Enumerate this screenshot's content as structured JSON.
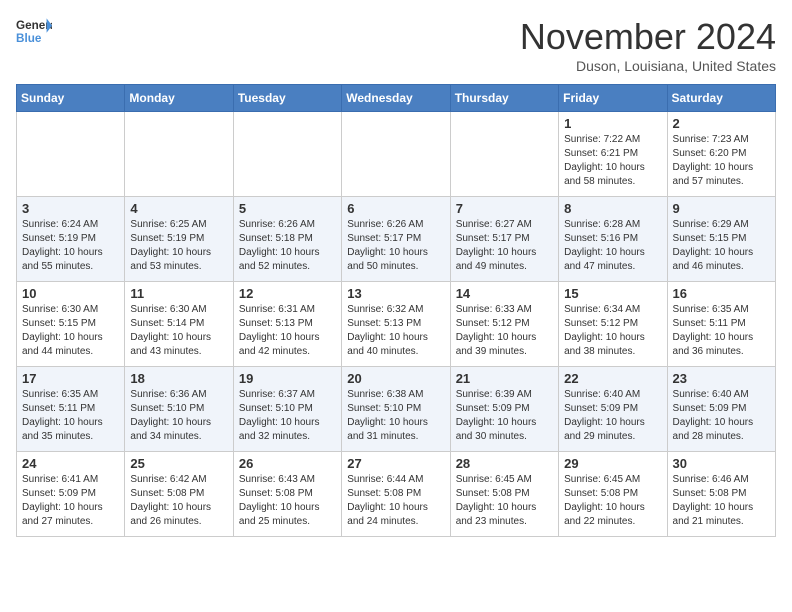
{
  "header": {
    "logo_line1": "General",
    "logo_line2": "Blue",
    "title": "November 2024",
    "subtitle": "Duson, Louisiana, United States"
  },
  "weekdays": [
    "Sunday",
    "Monday",
    "Tuesday",
    "Wednesday",
    "Thursday",
    "Friday",
    "Saturday"
  ],
  "weeks": [
    [
      {
        "day": "",
        "info": ""
      },
      {
        "day": "",
        "info": ""
      },
      {
        "day": "",
        "info": ""
      },
      {
        "day": "",
        "info": ""
      },
      {
        "day": "",
        "info": ""
      },
      {
        "day": "1",
        "info": "Sunrise: 7:22 AM\nSunset: 6:21 PM\nDaylight: 10 hours and 58 minutes."
      },
      {
        "day": "2",
        "info": "Sunrise: 7:23 AM\nSunset: 6:20 PM\nDaylight: 10 hours and 57 minutes."
      }
    ],
    [
      {
        "day": "3",
        "info": "Sunrise: 6:24 AM\nSunset: 5:19 PM\nDaylight: 10 hours and 55 minutes."
      },
      {
        "day": "4",
        "info": "Sunrise: 6:25 AM\nSunset: 5:19 PM\nDaylight: 10 hours and 53 minutes."
      },
      {
        "day": "5",
        "info": "Sunrise: 6:26 AM\nSunset: 5:18 PM\nDaylight: 10 hours and 52 minutes."
      },
      {
        "day": "6",
        "info": "Sunrise: 6:26 AM\nSunset: 5:17 PM\nDaylight: 10 hours and 50 minutes."
      },
      {
        "day": "7",
        "info": "Sunrise: 6:27 AM\nSunset: 5:17 PM\nDaylight: 10 hours and 49 minutes."
      },
      {
        "day": "8",
        "info": "Sunrise: 6:28 AM\nSunset: 5:16 PM\nDaylight: 10 hours and 47 minutes."
      },
      {
        "day": "9",
        "info": "Sunrise: 6:29 AM\nSunset: 5:15 PM\nDaylight: 10 hours and 46 minutes."
      }
    ],
    [
      {
        "day": "10",
        "info": "Sunrise: 6:30 AM\nSunset: 5:15 PM\nDaylight: 10 hours and 44 minutes."
      },
      {
        "day": "11",
        "info": "Sunrise: 6:30 AM\nSunset: 5:14 PM\nDaylight: 10 hours and 43 minutes."
      },
      {
        "day": "12",
        "info": "Sunrise: 6:31 AM\nSunset: 5:13 PM\nDaylight: 10 hours and 42 minutes."
      },
      {
        "day": "13",
        "info": "Sunrise: 6:32 AM\nSunset: 5:13 PM\nDaylight: 10 hours and 40 minutes."
      },
      {
        "day": "14",
        "info": "Sunrise: 6:33 AM\nSunset: 5:12 PM\nDaylight: 10 hours and 39 minutes."
      },
      {
        "day": "15",
        "info": "Sunrise: 6:34 AM\nSunset: 5:12 PM\nDaylight: 10 hours and 38 minutes."
      },
      {
        "day": "16",
        "info": "Sunrise: 6:35 AM\nSunset: 5:11 PM\nDaylight: 10 hours and 36 minutes."
      }
    ],
    [
      {
        "day": "17",
        "info": "Sunrise: 6:35 AM\nSunset: 5:11 PM\nDaylight: 10 hours and 35 minutes."
      },
      {
        "day": "18",
        "info": "Sunrise: 6:36 AM\nSunset: 5:10 PM\nDaylight: 10 hours and 34 minutes."
      },
      {
        "day": "19",
        "info": "Sunrise: 6:37 AM\nSunset: 5:10 PM\nDaylight: 10 hours and 32 minutes."
      },
      {
        "day": "20",
        "info": "Sunrise: 6:38 AM\nSunset: 5:10 PM\nDaylight: 10 hours and 31 minutes."
      },
      {
        "day": "21",
        "info": "Sunrise: 6:39 AM\nSunset: 5:09 PM\nDaylight: 10 hours and 30 minutes."
      },
      {
        "day": "22",
        "info": "Sunrise: 6:40 AM\nSunset: 5:09 PM\nDaylight: 10 hours and 29 minutes."
      },
      {
        "day": "23",
        "info": "Sunrise: 6:40 AM\nSunset: 5:09 PM\nDaylight: 10 hours and 28 minutes."
      }
    ],
    [
      {
        "day": "24",
        "info": "Sunrise: 6:41 AM\nSunset: 5:09 PM\nDaylight: 10 hours and 27 minutes."
      },
      {
        "day": "25",
        "info": "Sunrise: 6:42 AM\nSunset: 5:08 PM\nDaylight: 10 hours and 26 minutes."
      },
      {
        "day": "26",
        "info": "Sunrise: 6:43 AM\nSunset: 5:08 PM\nDaylight: 10 hours and 25 minutes."
      },
      {
        "day": "27",
        "info": "Sunrise: 6:44 AM\nSunset: 5:08 PM\nDaylight: 10 hours and 24 minutes."
      },
      {
        "day": "28",
        "info": "Sunrise: 6:45 AM\nSunset: 5:08 PM\nDaylight: 10 hours and 23 minutes."
      },
      {
        "day": "29",
        "info": "Sunrise: 6:45 AM\nSunset: 5:08 PM\nDaylight: 10 hours and 22 minutes."
      },
      {
        "day": "30",
        "info": "Sunrise: 6:46 AM\nSunset: 5:08 PM\nDaylight: 10 hours and 21 minutes."
      }
    ]
  ]
}
